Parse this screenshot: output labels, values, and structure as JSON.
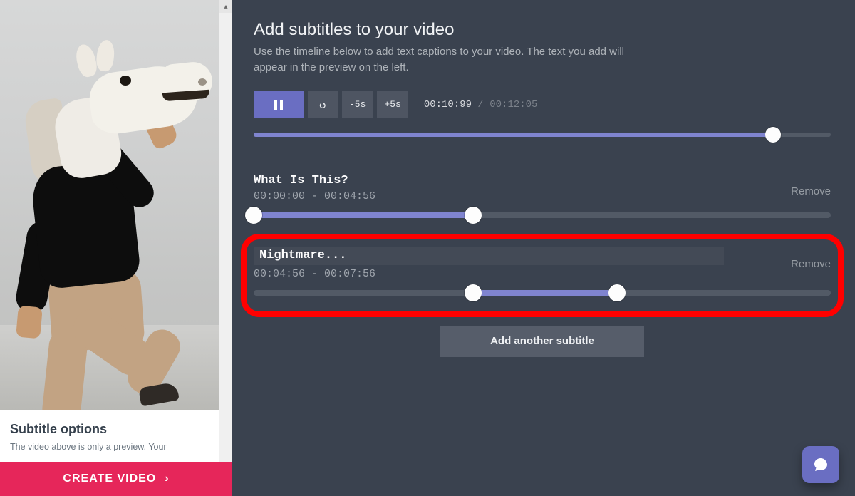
{
  "left": {
    "subtitle_options_heading": "Subtitle options",
    "subtitle_options_desc": "The video above is only a preview. Your",
    "create_button": "CREATE VIDEO"
  },
  "header": {
    "title": "Add subtitles to your video",
    "subtitle": "Use the timeline below to add text captions to your video. The text you add will appear in the preview on the left."
  },
  "controls": {
    "rewind5_label": "-5s",
    "forward5_label": "+5s",
    "current_time": "00:10:99",
    "sep": " / ",
    "total_time": "00:12:05",
    "progress_pct": 90
  },
  "subtitles": [
    {
      "text": "What Is This?",
      "range_label": "00:00:00 - 00:04:56",
      "remove_label": "Remove",
      "start_pct": 0,
      "end_pct": 38,
      "editing": false
    },
    {
      "text": "Nightmare...",
      "range_label": "00:04:56 - 00:07:56",
      "remove_label": "Remove",
      "start_pct": 38,
      "end_pct": 63,
      "editing": true
    }
  ],
  "add_subtitle_label": "Add another subtitle",
  "colors": {
    "accent": "#6a6ec2",
    "cta": "#e6265a",
    "highlight": "#ff0000"
  }
}
